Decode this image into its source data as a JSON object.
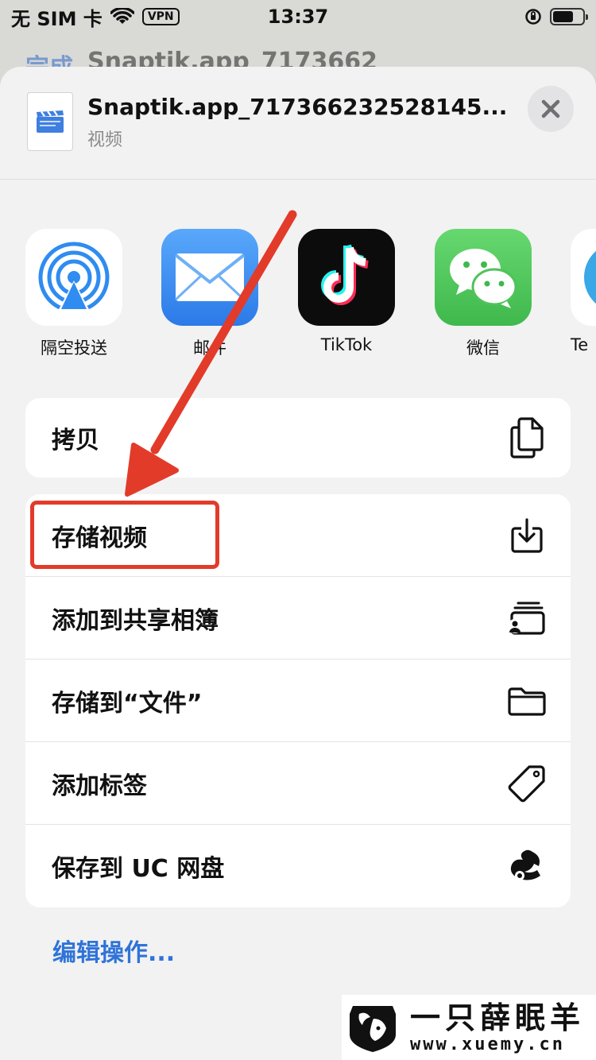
{
  "status_bar": {
    "carrier": "无 SIM 卡",
    "vpn": "VPN",
    "time": "13:37"
  },
  "background_nav": {
    "done": "完成",
    "title": "Snaptik.app_7173662"
  },
  "sheet": {
    "file_name": "Snaptik.app_717366232528145...",
    "file_type": "视频",
    "close_icon": "close-x-icon"
  },
  "apps": [
    {
      "label": "隔空投送",
      "icon": "airdrop-icon"
    },
    {
      "label": "邮件",
      "icon": "mail-icon"
    },
    {
      "label": "TikTok",
      "icon": "tiktok-icon"
    },
    {
      "label": "微信",
      "icon": "wechat-icon"
    },
    {
      "label": "Te",
      "icon": "telegram-icon"
    }
  ],
  "actions_group1": [
    {
      "label": "拷贝",
      "icon": "copy-icon"
    }
  ],
  "actions_group2": [
    {
      "label": "存储视频",
      "icon": "save-download-icon"
    },
    {
      "label": "添加到共享相簿",
      "icon": "shared-album-icon"
    },
    {
      "label": "存储到“文件”",
      "icon": "folder-icon"
    },
    {
      "label": "添加标签",
      "icon": "tag-icon"
    },
    {
      "label": "保存到 UC 网盘",
      "icon": "uc-squirrel-icon"
    }
  ],
  "edit_actions": "编辑操作...",
  "watermark": {
    "name": "一只薛眠羊",
    "url": "www.xuemy.cn"
  },
  "colors": {
    "accent_blue": "#2f73d9",
    "annotation_red": "#e23b2a",
    "mail_blue": "#3d8ef5",
    "wechat_green": "#4cc45a"
  }
}
